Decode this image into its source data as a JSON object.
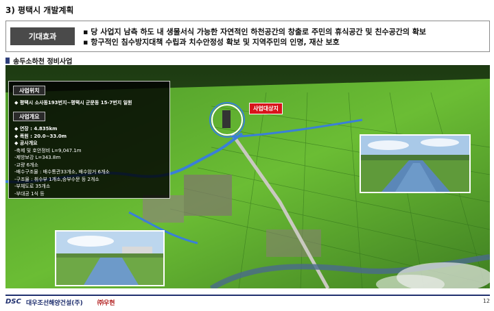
{
  "page": {
    "title": "3) 평택시 개발계획",
    "number": "12"
  },
  "effect": {
    "label": "기대효과",
    "lines": [
      "▪ 당 사업지 남측 하도 내 생물서식 가능한 자연적인 하천공간의 창출로 주민의 휴식공간 및 친수공간의 확보",
      "▪ 항구적인 침수방지대책 수립과 치수안정성 확보 및 지역주민의 인명, 재산 보호"
    ]
  },
  "section": {
    "title": "송두소하천 정비사업"
  },
  "info": {
    "location_head": "사업위치",
    "location_text": "◆ 평택시 소사동193번지~평택시 군문동 15-7번지 일원",
    "overview_head": "사업개요",
    "overview_lines": [
      "◆ 연장 : 4.835km",
      "◆ 폭원 : 20.0~33.0m",
      "◆ 공사개요",
      "  -축제 및 호안정비 L=9,047.1m",
      "  -제방보강 L=343.8m",
      "  -교량 6개소",
      "  -배수구조물 : 배수통관33개소, 배수암거 6개소",
      "  -구조물 : 취수부 1개소,승부수문 등 2개소",
      "  -부체도로 35개소",
      "  -부대공 1식 등"
    ]
  },
  "map": {
    "site_label": "사업대상지"
  },
  "footer": {
    "brand": "DSC",
    "company": "대우조선해양건설(주)",
    "partner": "㈜우현"
  },
  "colors": {
    "accent_navy": "#1f2f6e",
    "site_red": "#d8141b",
    "river_blue": "#3a7fd8"
  }
}
